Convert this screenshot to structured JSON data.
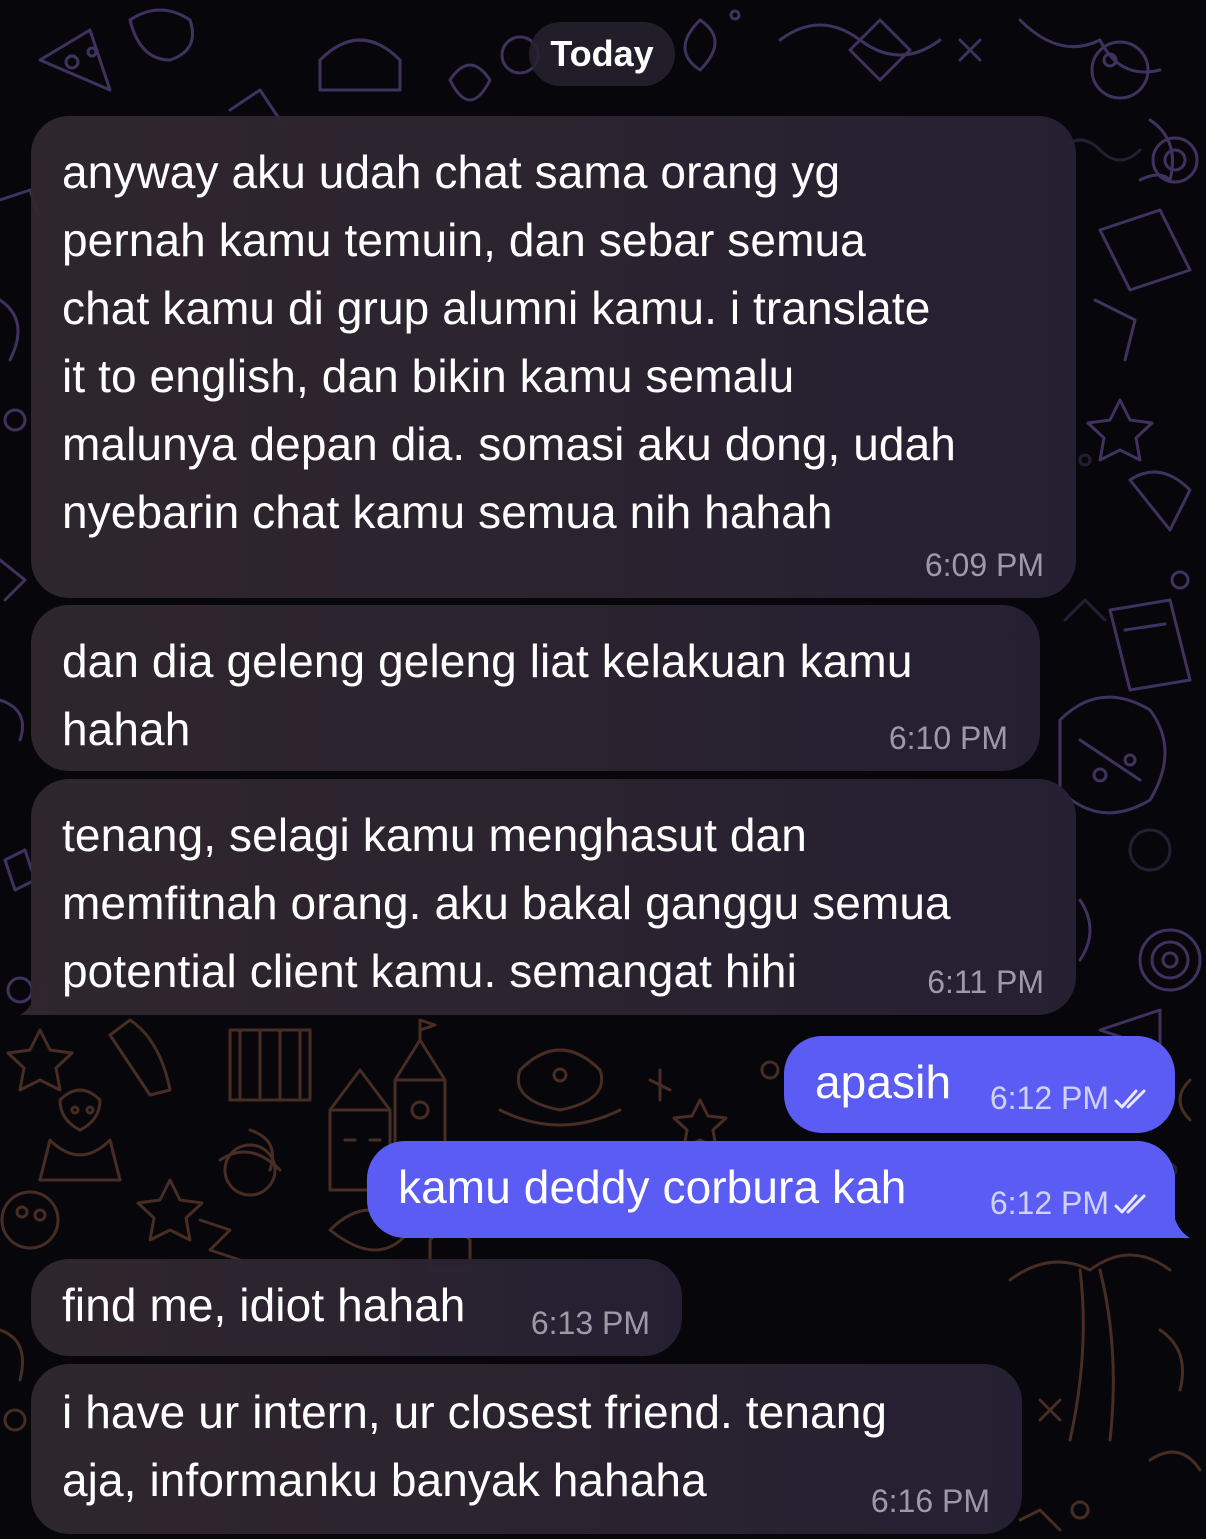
{
  "date_divider": "Today",
  "messages": [
    {
      "direction": "incoming",
      "text": "anyway aku udah chat sama orang yg\npernah kamu temuin, dan sebar semua\nchat kamu di grup alumni kamu. i translate\nit to english, dan bikin kamu semalu\nmalunya depan dia. somasi aku dong, udah\nnyebarin chat kamu semua nih hahah",
      "time": "6:09 PM"
    },
    {
      "direction": "incoming",
      "text": "dan dia geleng geleng liat kelakuan kamu\nhahah",
      "time": "6:10 PM"
    },
    {
      "direction": "incoming",
      "text": "tenang, selagi kamu menghasut dan\nmemfitnah orang. aku bakal ganggu semua\npotential client kamu. semangat hihi",
      "time": "6:11 PM"
    },
    {
      "direction": "outgoing",
      "text": "apasih",
      "time": "6:12 PM",
      "status": "read"
    },
    {
      "direction": "outgoing",
      "text": "kamu deddy corbura kah",
      "time": "6:12 PM",
      "status": "read"
    },
    {
      "direction": "incoming",
      "text": "find me, idiot hahah",
      "time": "6:13 PM"
    },
    {
      "direction": "incoming",
      "text": "i have ur intern, ur closest friend. tenang\naja, informanku banyak hahaha",
      "time": "6:16 PM"
    }
  ],
  "colors": {
    "background": "#07060a",
    "incoming_bubble": "#2e2530",
    "outgoing_bubble": "#5b5cf3",
    "doodle_purple": "#5a4580",
    "doodle_brown": "#4a3128"
  },
  "icons": [
    "double-check-icon",
    "doodle-wallpaper"
  ]
}
